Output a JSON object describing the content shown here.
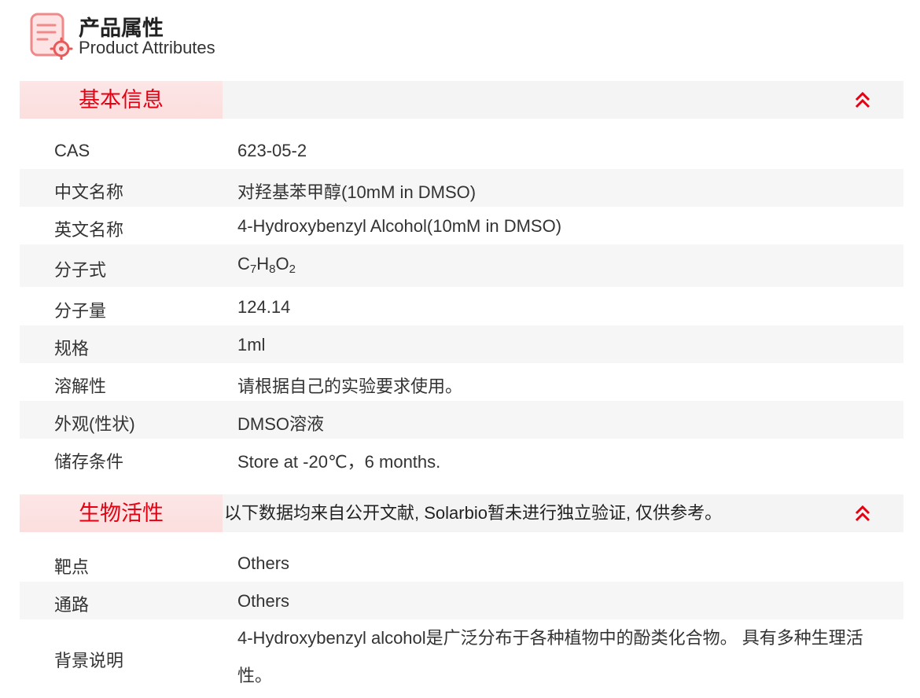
{
  "header": {
    "title_cn": "产品属性",
    "title_en": "Product Attributes",
    "icon": "document-gear-icon",
    "accent_color": "#e60012"
  },
  "basic_info": {
    "title": "基本信息",
    "collapse_icon": "double-chevron-up-icon",
    "rows": [
      {
        "label": "CAS",
        "value": "623-05-2"
      },
      {
        "label": "中文名称",
        "value": "对羟基苯甲醇(10mM in DMSO)"
      },
      {
        "label": "英文名称",
        "value": "4-Hydroxybenzyl Alcohol(10mM in DMSO)"
      },
      {
        "label": "分子式",
        "formula": {
          "c": "C",
          "c_n": "7",
          "h": "H",
          "h_n": "8",
          "o": "O",
          "o_n": "2"
        }
      },
      {
        "label": "分子量",
        "value": "124.14"
      },
      {
        "label": "规格",
        "value": "1ml"
      },
      {
        "label": "溶解性",
        "value": "请根据自己的实验要求使用。"
      },
      {
        "label": "外观(性状)",
        "value": "DMSO溶液"
      },
      {
        "label": "储存条件",
        "value": "Store at -20℃，6 months."
      }
    ]
  },
  "bio_activity": {
    "title": "生物活性",
    "note": "以下数据均来自公开文献, Solarbio暂未进行独立验证, 仅供参考。",
    "collapse_icon": "double-chevron-up-icon",
    "rows": [
      {
        "label": "靶点",
        "value": "Others"
      },
      {
        "label": "通路",
        "value": "Others"
      },
      {
        "label": "背景说明",
        "value": "4-Hydroxybenzyl alcohol是广泛分布于各种植物中的酚类化合物。 具有多种生理活性。"
      }
    ]
  }
}
